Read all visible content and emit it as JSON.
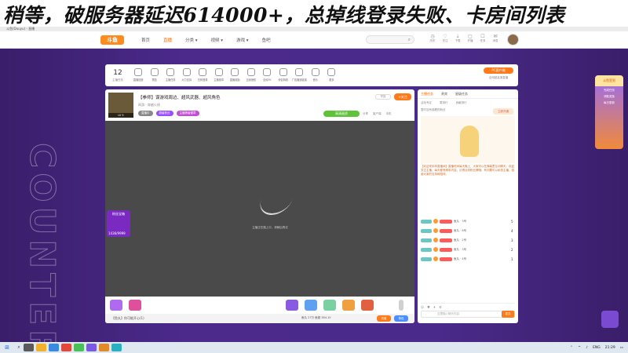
{
  "banner": {
    "text": "稍等，破服务器延迟614000+，总掉线登录失败、卡房间列表"
  },
  "browser": {
    "tab_title": "斗鱼(Douyu) - 直播"
  },
  "header": {
    "logo": "斗鱼",
    "nav": [
      "首页",
      "直播",
      "分类 ▾",
      "视频 ▾",
      "游戏 ▾",
      "鱼吧"
    ],
    "icons": [
      {
        "name": "history-icon",
        "glyph": "◷",
        "label": "历史"
      },
      {
        "name": "follow-icon",
        "glyph": "♡",
        "label": "关注"
      },
      {
        "name": "download-icon",
        "glyph": "⇣",
        "label": "下载"
      },
      {
        "name": "live-icon",
        "glyph": "▢",
        "label": "开播"
      },
      {
        "name": "task-icon",
        "glyph": "☐",
        "label": "任务"
      },
      {
        "name": "message-icon",
        "glyph": "✉",
        "label": "消息"
      }
    ]
  },
  "categories": {
    "count": "12",
    "count_label": "主播任务",
    "items": [
      "直播回放",
      "预告",
      "主播任务",
      "大力支持",
      "扫码登录",
      "主播勋章",
      "直播奖励",
      "正版授权",
      "全民PK",
      "伴侣特权",
      "广告播放链接",
      "音乐",
      "更多"
    ],
    "pc_button": "PC客户端",
    "pc_sub": "全网超高清直播"
  },
  "room": {
    "title": "【拳师】谋游戏周边、超风武器、超风角色",
    "meta": "网游 · 穿越火线",
    "level": "LV 5",
    "chips": [
      "直播中",
      "超级粉丝 ",
      "主播等级徽章"
    ],
    "report": "举报",
    "follow": "+关注",
    "quality": "高清画质",
    "actions": [
      "分享",
      "客户端",
      "手机"
    ],
    "video_message": "主播正在路上中，请稍后再试",
    "float_tag": "粉丝宝箱",
    "float_count": "1436/9999",
    "gift_note": "【鱼丸】你可能开心(1)",
    "balance": "鱼丸 27万  鱼翅 384.10",
    "recharge": "充值",
    "pack": "背包"
  },
  "chat": {
    "tabs": [
      "主播任务",
      "贵宾",
      "星级任务"
    ],
    "sub_tabs": [
      "活动专区",
      "周排行",
      "贡献排行"
    ],
    "notice": "暂时没有观看的粉丝",
    "notice_bubble": "立即开通",
    "announce": "【欢迎来到本直播间】直播时间每天晚上，大家可以在弹幕里互动聊天，欢迎关注主播，每天都有精彩内容，记得点亮粉丝牌哦，有问题可以私信主播，感谢大家的支持和陪伴。",
    "messages": [
      {
        "name": "鱼丸 · 3号",
        "count": "5"
      },
      {
        "name": "鱼丸 · 6号",
        "count": "4"
      },
      {
        "name": "鱼丸 · 2号",
        "count": "3"
      },
      {
        "name": "鱼丸 · 3号",
        "count": "2"
      },
      {
        "name": "鱼丸 · 4号",
        "count": "1"
      }
    ],
    "input_placeholder": "这里输入聊天内容",
    "send": "发送"
  },
  "ads": {
    "right_top": "斗鱼签到",
    "right_lines": [
      "完成任务",
      "领取奖励",
      "每日更新"
    ]
  },
  "taskbar": {
    "lang": "ENG",
    "time": "21:29"
  }
}
